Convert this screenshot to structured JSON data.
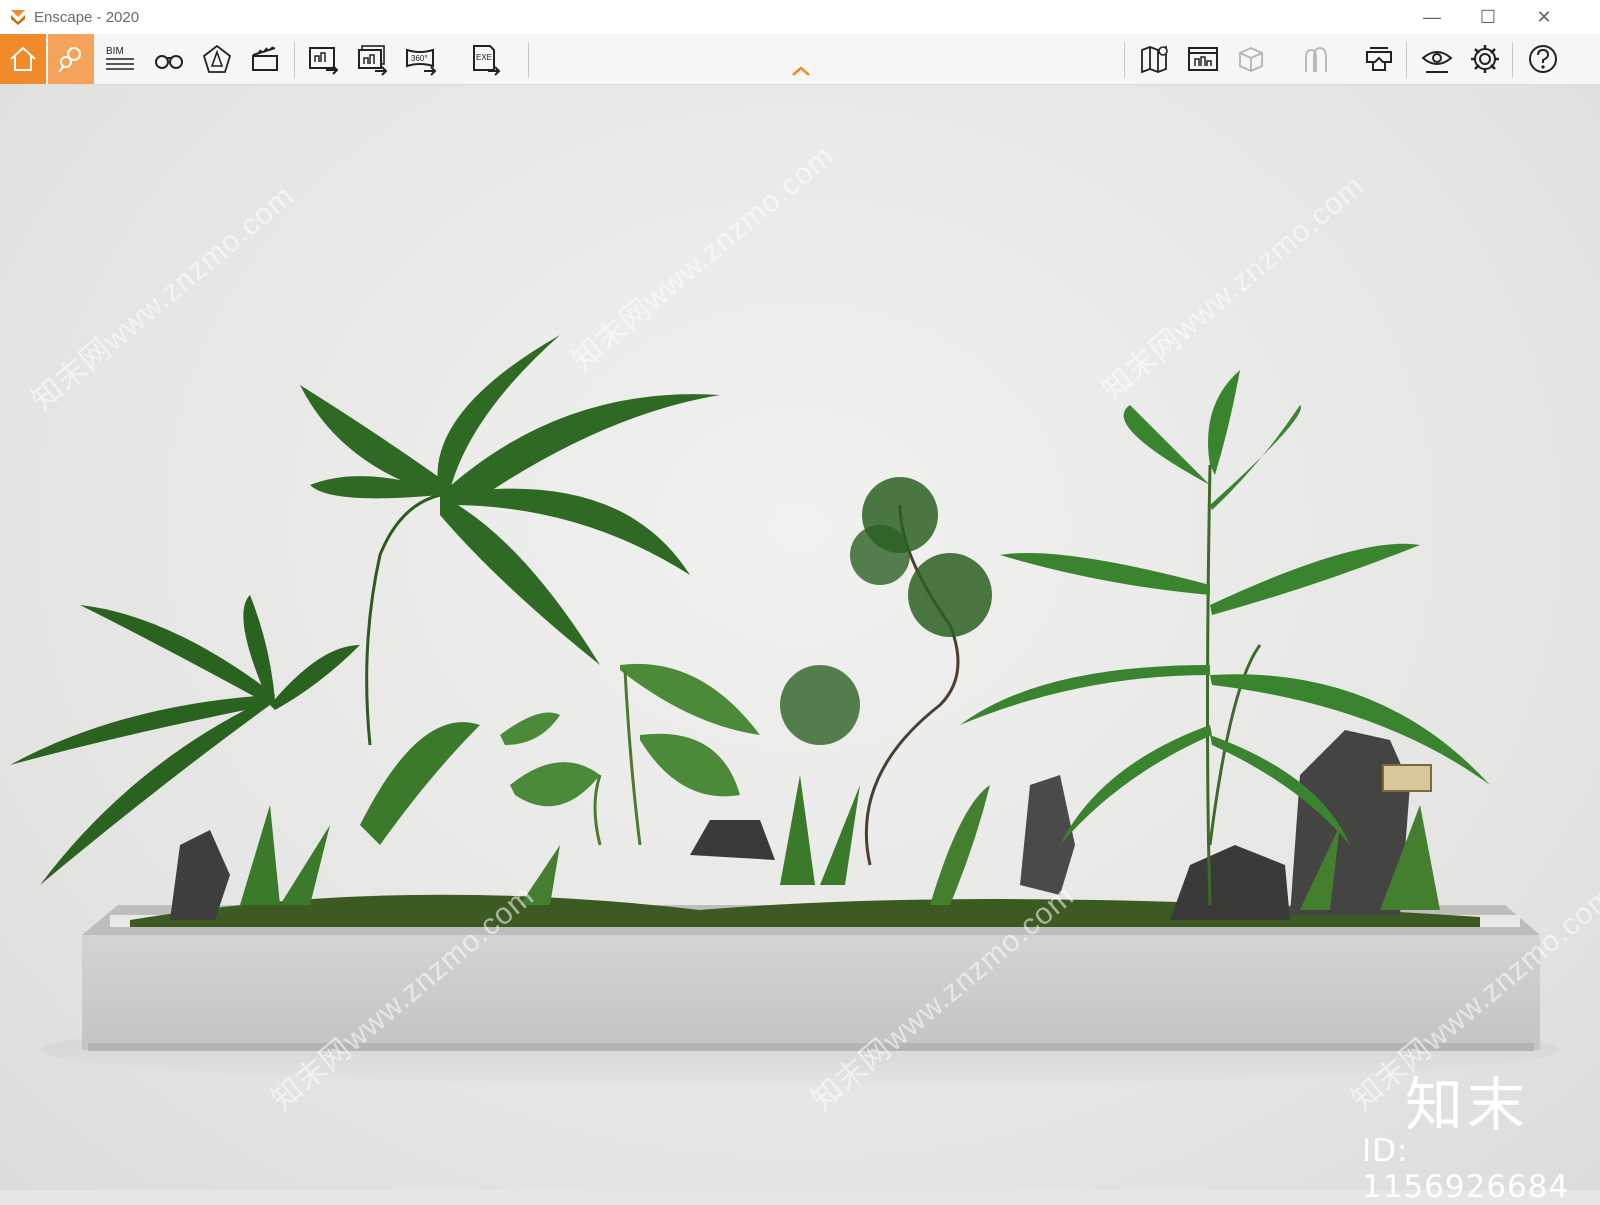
{
  "app": {
    "title": "Enscape - 2020",
    "accent_color": "#f18a2a"
  },
  "window_controls": {
    "minimize": "—",
    "maximize": "☐",
    "close": "✕"
  },
  "toolbar": {
    "left": [
      {
        "icon": "home-icon",
        "active": true
      },
      {
        "icon": "location-pins-icon",
        "active": true
      },
      {
        "icon": "bim-icon",
        "label": "BIM"
      },
      {
        "icon": "binoculars-icon"
      },
      {
        "icon": "light-view-icon"
      },
      {
        "icon": "clapperboard-icon"
      },
      {
        "icon": "render-export-icon"
      },
      {
        "icon": "batch-render-icon"
      },
      {
        "icon": "panorama-360-icon",
        "label": "360°"
      },
      {
        "icon": "exe-export-icon",
        "label": "EXE"
      }
    ],
    "right": [
      {
        "icon": "map-pin-icon"
      },
      {
        "icon": "asset-library-icon"
      },
      {
        "icon": "cube-icon"
      },
      {
        "icon": "vr-people-icon"
      },
      {
        "icon": "vr-headset-icon"
      },
      {
        "icon": "eye-settings-icon"
      },
      {
        "icon": "gear-icon"
      },
      {
        "icon": "help-icon"
      }
    ]
  },
  "viewport": {
    "watermark_text": "知末网www.znzmo.com",
    "logo_text": "知末",
    "id_text": "ID: 1156926684"
  }
}
